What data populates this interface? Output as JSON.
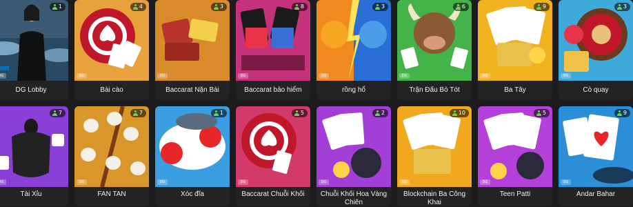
{
  "games": [
    {
      "name": "DG Lobby",
      "players": "1",
      "bg": "#5a7f9c"
    },
    {
      "name": "Bài cào",
      "players": "4",
      "bg": "#e8a23c"
    },
    {
      "name": "Baccarat Nặn Bài",
      "players": "3",
      "bg": "#d98a2a"
    },
    {
      "name": "Baccarat bảo hiểm",
      "players": "8",
      "bg": "#c5317a"
    },
    {
      "name": "rồng hổ",
      "players": "3",
      "bg": "#f08a1e"
    },
    {
      "name": "Trận Đấu Bò Tót",
      "players": "6",
      "bg": "#44b34a"
    },
    {
      "name": "Ba Tây",
      "players": "9",
      "bg": "#f0b21e"
    },
    {
      "name": "Cò quay",
      "players": "3",
      "bg": "#3fa9d9"
    },
    {
      "name": "Tài Xỉu",
      "players": "7",
      "bg": "#8a3fd6"
    },
    {
      "name": "FAN TAN",
      "players": "7",
      "bg": "#d9962a"
    },
    {
      "name": "Xóc đĩa",
      "players": "1",
      "bg": "#3a9ee0"
    },
    {
      "name": "Baccarat Chuỗi Khối",
      "players": "5",
      "bg": "#d23a6a"
    },
    {
      "name": "Chuỗi Khối Hoa Vàng Chiên",
      "players": "2",
      "bg": "#a23fd6"
    },
    {
      "name": "Blockchain Ba Công Khai",
      "players": "10",
      "bg": "#f0a81e"
    },
    {
      "name": "Teen Patti",
      "players": "5",
      "bg": "#b43fd9"
    },
    {
      "name": "Andar Bahar",
      "players": "9",
      "bg": "#2a8fd6"
    }
  ]
}
